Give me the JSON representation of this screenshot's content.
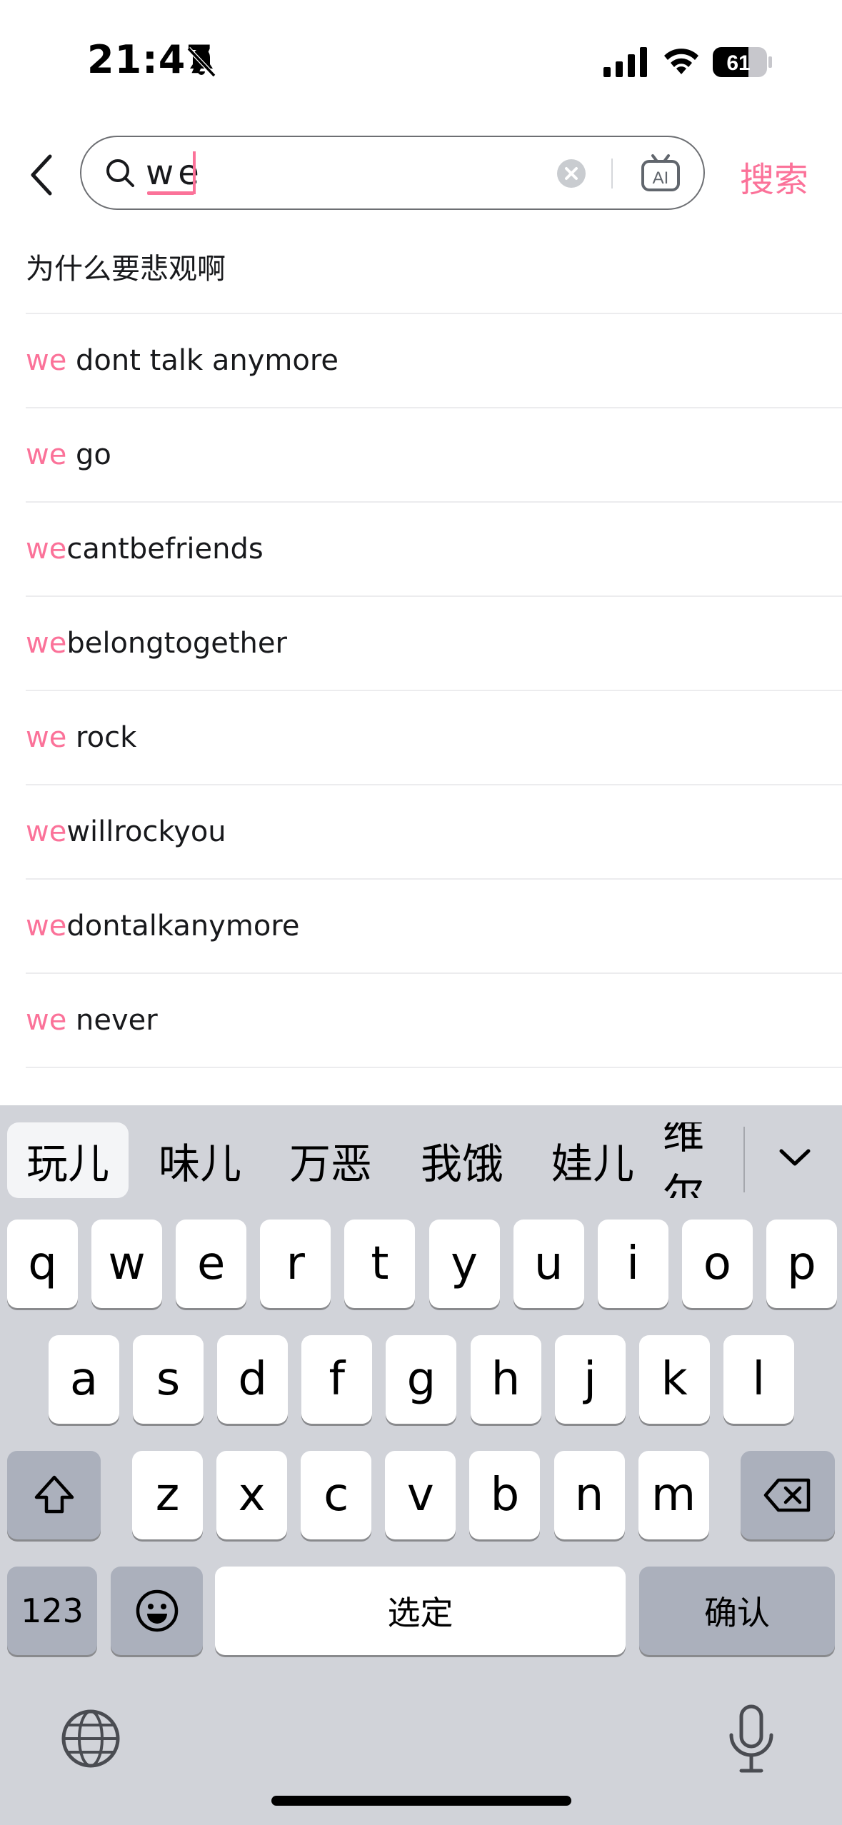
{
  "status_bar": {
    "time": "21:47",
    "battery": "61"
  },
  "search": {
    "query": "we",
    "submit_label": "搜索",
    "ai_label": "AI",
    "accent_color": "#fb7299"
  },
  "suggestions": [
    {
      "highlight": "",
      "rest": "为什么要悲观啊"
    },
    {
      "highlight": "we",
      "rest": " dont talk anymore"
    },
    {
      "highlight": "we",
      "rest": " go"
    },
    {
      "highlight": "we",
      "rest": "cantbefriends"
    },
    {
      "highlight": "we",
      "rest": "belongtogether"
    },
    {
      "highlight": "we",
      "rest": " rock"
    },
    {
      "highlight": "we",
      "rest": "willrockyou"
    },
    {
      "highlight": "we",
      "rest": "dontalkanymore"
    },
    {
      "highlight": "we",
      "rest": " never"
    }
  ],
  "keyboard": {
    "candidates": [
      "玩儿",
      "味儿",
      "万恶",
      "我饿",
      "娃儿",
      "维尔"
    ],
    "row1": [
      "q",
      "w",
      "e",
      "r",
      "t",
      "y",
      "u",
      "i",
      "o",
      "p"
    ],
    "row2": [
      "a",
      "s",
      "d",
      "f",
      "g",
      "h",
      "j",
      "k",
      "l"
    ],
    "row3": [
      "z",
      "x",
      "c",
      "v",
      "b",
      "n",
      "m"
    ],
    "numbers_label": "123",
    "space_label": "选定",
    "confirm_label": "确认"
  }
}
